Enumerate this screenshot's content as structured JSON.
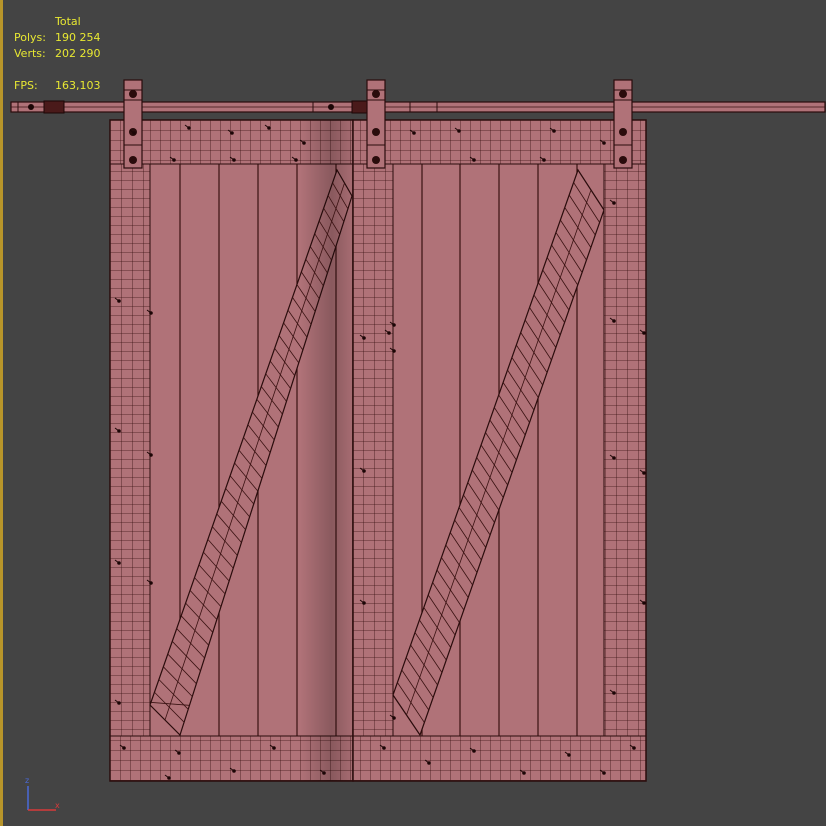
{
  "viewport": {
    "background": "#444444",
    "stats": {
      "header": "Total",
      "polys_label": "Polys:",
      "polys_value": "190 254",
      "verts_label": "Verts:",
      "verts_value": "202 290",
      "fps_label": "FPS:",
      "fps_value": "163,103",
      "text_color": "#e8e832"
    },
    "model": {
      "name": "sliding barn door pair with rail",
      "wireframe_color": "#3a1212",
      "surface_color": "#b07278"
    },
    "gizmo": {
      "axes": [
        "z",
        "x"
      ],
      "z_color": "#4a6ad8",
      "x_color": "#d83a3a"
    }
  }
}
